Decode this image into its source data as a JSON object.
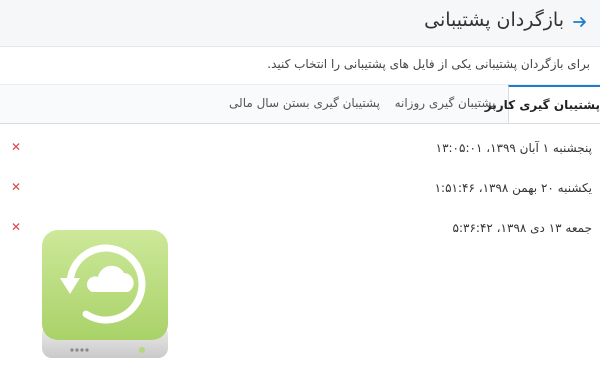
{
  "header": {
    "title": "بازگردان پشتیبانی",
    "back_icon": "arrow-right-icon"
  },
  "intro_text": "برای بازگردان پشتیبانی یکی از فایل های پشتیبانی را انتخاب کنید.",
  "tabs": [
    {
      "label": "پشتیبان گیری کاربر",
      "active": true
    },
    {
      "label": "پشتیبان گیری روزانه",
      "active": false
    },
    {
      "label": "پشتیبان گیری بستن سال مالی",
      "active": false
    }
  ],
  "backups": [
    {
      "date": "پنجشنبه ۱ آبان ۱۳۹۹، ۱۳:۰۵:۰۱",
      "delete_icon": "close-icon"
    },
    {
      "date": "یکشنبه ۲۰ بهمن ۱۳۹۸، ۱:۵۱:۴۶",
      "delete_icon": "close-icon"
    },
    {
      "date": "جمعه ۱۳ دی ۱۳۹۸، ۵:۳۶:۴۲",
      "delete_icon": "close-icon"
    }
  ],
  "colors": {
    "accent": "#1e7bd0",
    "delete": "#e04646",
    "icon_green": "#b4d97a"
  }
}
